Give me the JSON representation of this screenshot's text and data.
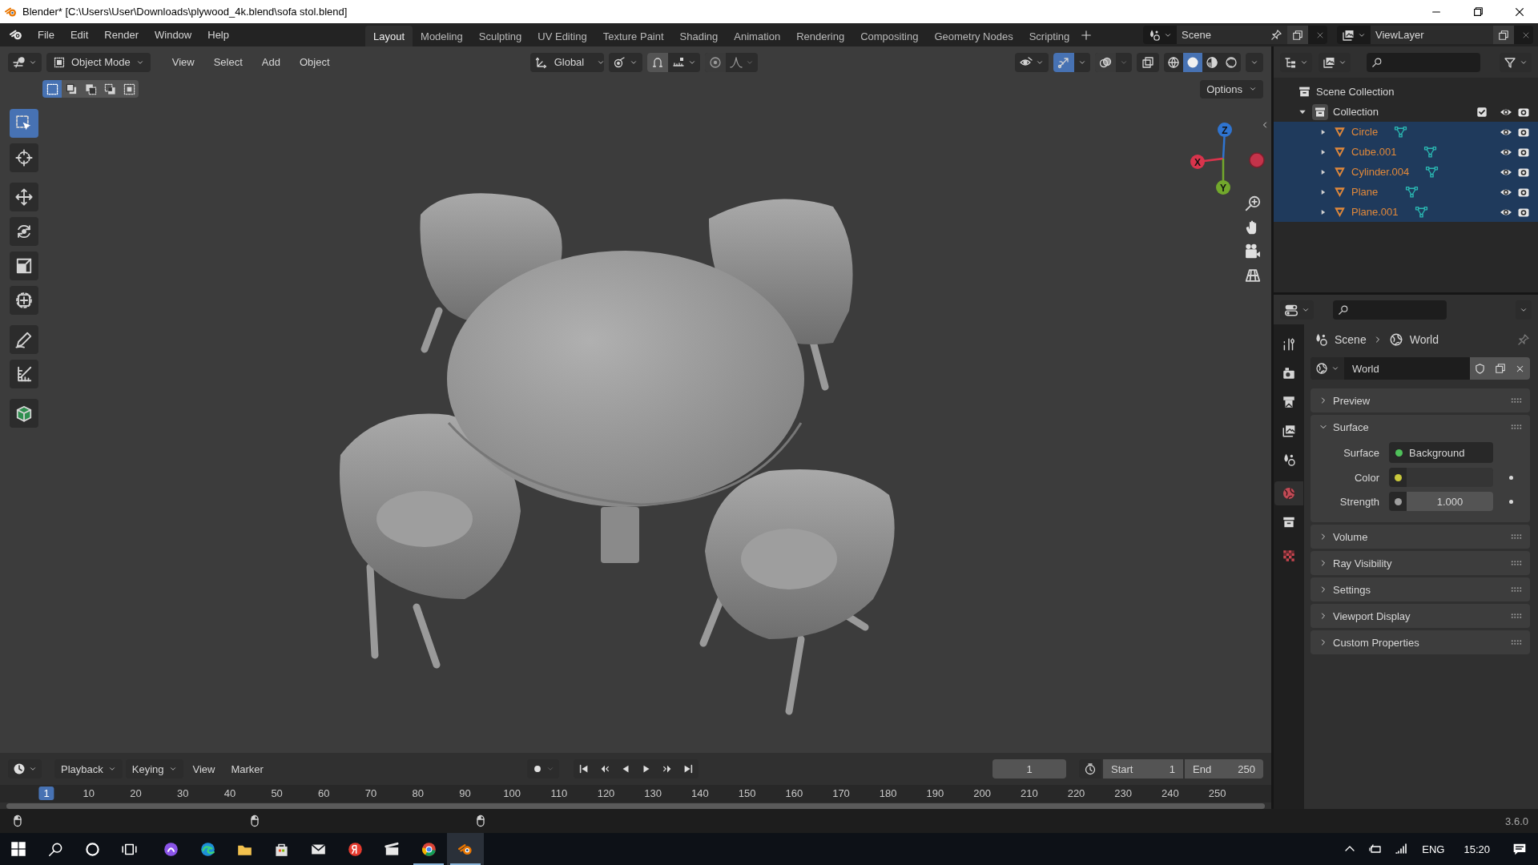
{
  "window": {
    "title": "Blender* [C:\\Users\\User\\Downloads\\plywood_4k.blend\\sofa stol.blend]"
  },
  "topbar": {
    "menus": [
      "File",
      "Edit",
      "Render",
      "Window",
      "Help"
    ],
    "workspaces": [
      {
        "label": "Layout",
        "selected": true
      },
      {
        "label": "Modeling",
        "selected": false
      },
      {
        "label": "Sculpting",
        "selected": false
      },
      {
        "label": "UV Editing",
        "selected": false
      },
      {
        "label": "Texture Paint",
        "selected": false
      },
      {
        "label": "Shading",
        "selected": false
      },
      {
        "label": "Animation",
        "selected": false
      },
      {
        "label": "Rendering",
        "selected": false
      },
      {
        "label": "Compositing",
        "selected": false
      },
      {
        "label": "Geometry Nodes",
        "selected": false
      },
      {
        "label": "Scripting",
        "selected": false
      }
    ],
    "scene": "Scene",
    "view_layer": "ViewLayer"
  },
  "viewport": {
    "mode": "Object Mode",
    "menus": [
      "View",
      "Select",
      "Add",
      "Object"
    ],
    "orientation": "Global",
    "options": "Options",
    "select_modes": [
      {
        "selected": true
      },
      {
        "selected": false
      },
      {
        "selected": false
      },
      {
        "selected": false
      },
      {
        "selected": false
      }
    ],
    "shading_modes": [
      {
        "kind": "wireframe",
        "selected": false
      },
      {
        "kind": "solid",
        "selected": true
      },
      {
        "kind": "material",
        "selected": false
      },
      {
        "kind": "rendered",
        "selected": false
      }
    ],
    "tools": [
      {
        "kind": "select",
        "selected": true
      },
      {
        "kind": "cursor",
        "selected": false
      },
      {
        "kind": "move",
        "selected": false
      },
      {
        "kind": "rotate",
        "selected": false
      },
      {
        "kind": "scale",
        "selected": false
      },
      {
        "kind": "transform",
        "selected": false
      },
      {
        "kind": "annotate",
        "selected": false
      },
      {
        "kind": "measure",
        "selected": false
      },
      {
        "kind": "add-cube",
        "selected": false
      }
    ],
    "axes": [
      {
        "label": "Z",
        "color": "#2f74d0"
      },
      {
        "label": "X",
        "color": "#d9344c"
      },
      {
        "label": "Y",
        "color": "#72a82c"
      }
    ]
  },
  "outliner": {
    "root": "Scene Collection",
    "collection": {
      "name": "Collection",
      "expanded": true,
      "checked": true,
      "children": [
        {
          "name": "Circle",
          "selected": true
        },
        {
          "name": "Cube.001",
          "selected": true
        },
        {
          "name": "Cylinder.004",
          "selected": true
        },
        {
          "name": "Plane",
          "selected": true
        },
        {
          "name": "Plane.001",
          "selected": true
        }
      ]
    }
  },
  "properties": {
    "tabs": [
      {
        "kind": "tool",
        "selected": false
      },
      {
        "kind": "render",
        "selected": false
      },
      {
        "kind": "output",
        "selected": false
      },
      {
        "kind": "view-layer",
        "selected": false
      },
      {
        "kind": "scene",
        "selected": false
      },
      {
        "kind": "world",
        "selected": true
      },
      {
        "kind": "collection",
        "selected": false
      },
      {
        "kind": "texture",
        "selected": false
      }
    ],
    "breadcrumb": [
      "Scene",
      "World"
    ],
    "world": "World",
    "panels": [
      {
        "title": "Preview",
        "expanded": false
      },
      {
        "title": "Surface",
        "expanded": true,
        "fields": [
          {
            "label": "Surface",
            "kind": "shader",
            "value": "Background",
            "color": "#4fc15a"
          },
          {
            "label": "Color",
            "kind": "color",
            "color": "#c9c83c"
          },
          {
            "label": "Strength",
            "kind": "number",
            "value": "1.000",
            "color": "#a0a0a0"
          }
        ]
      },
      {
        "title": "Volume",
        "expanded": false
      },
      {
        "title": "Ray Visibility",
        "expanded": false
      },
      {
        "title": "Settings",
        "expanded": false
      },
      {
        "title": "Viewport Display",
        "expanded": false
      },
      {
        "title": "Custom Properties",
        "expanded": false
      }
    ]
  },
  "timeline": {
    "menus": [
      {
        "label": "Playback",
        "dropdown": true
      },
      {
        "label": "Keying",
        "dropdown": true
      },
      {
        "label": "View",
        "dropdown": false
      },
      {
        "label": "Marker",
        "dropdown": false
      }
    ],
    "current_frame": "1",
    "start_label": "Start",
    "start": "1",
    "end_label": "End",
    "end": "250",
    "playhead": "1",
    "ticks": [
      "10",
      "20",
      "30",
      "40",
      "50",
      "60",
      "70",
      "80",
      "90",
      "100",
      "110",
      "120",
      "130",
      "140",
      "150",
      "160",
      "170",
      "180",
      "190",
      "200",
      "210",
      "220",
      "230",
      "240",
      "250"
    ]
  },
  "status_bar": {
    "version": "3.6.0"
  },
  "taskbar": {
    "language": "ENG",
    "time": "15:20"
  }
}
